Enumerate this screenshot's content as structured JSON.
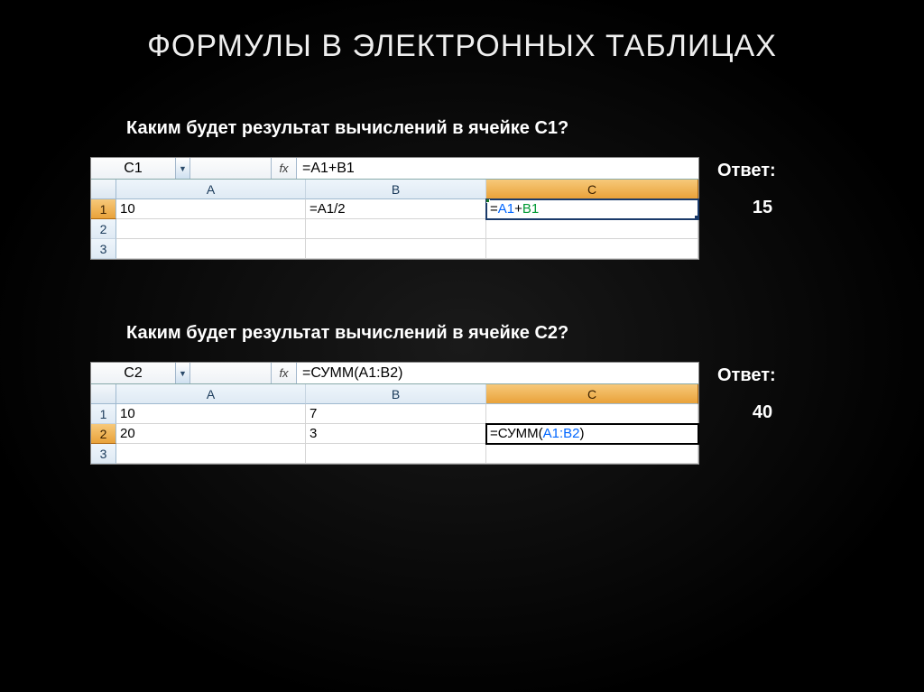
{
  "title": "ФОРМУЛЫ В ЭЛЕКТРОННЫХ ТАБЛИЦАХ",
  "labels": {
    "answer": "Ответ:",
    "fx": "fx"
  },
  "ex1": {
    "question": "Каким будет результат вычислений в ячейке С1?",
    "namebox": "C1",
    "formula_bar": "=A1+B1",
    "columns": [
      "A",
      "B",
      "C"
    ],
    "rows": [
      "1",
      "2",
      "3"
    ],
    "cells": {
      "A1": "10",
      "B1": "=A1/2",
      "C1_pre": "=",
      "C1_a": "A1",
      "C1_plus": "+",
      "C1_b": "B1"
    },
    "answer_value": "15"
  },
  "ex2": {
    "question": "Каким будет результат вычислений в ячейке С2?",
    "namebox": "C2",
    "formula_bar": "=СУММ(A1:B2)",
    "columns": [
      "A",
      "B",
      "C"
    ],
    "rows": [
      "1",
      "2",
      "3"
    ],
    "cells": {
      "A1": "10",
      "B1": "7",
      "A2": "20",
      "B2": "3",
      "C2_pre": "=СУММ(",
      "C2_range": "A1:B2",
      "C2_post": ")"
    },
    "answer_value": "40"
  }
}
